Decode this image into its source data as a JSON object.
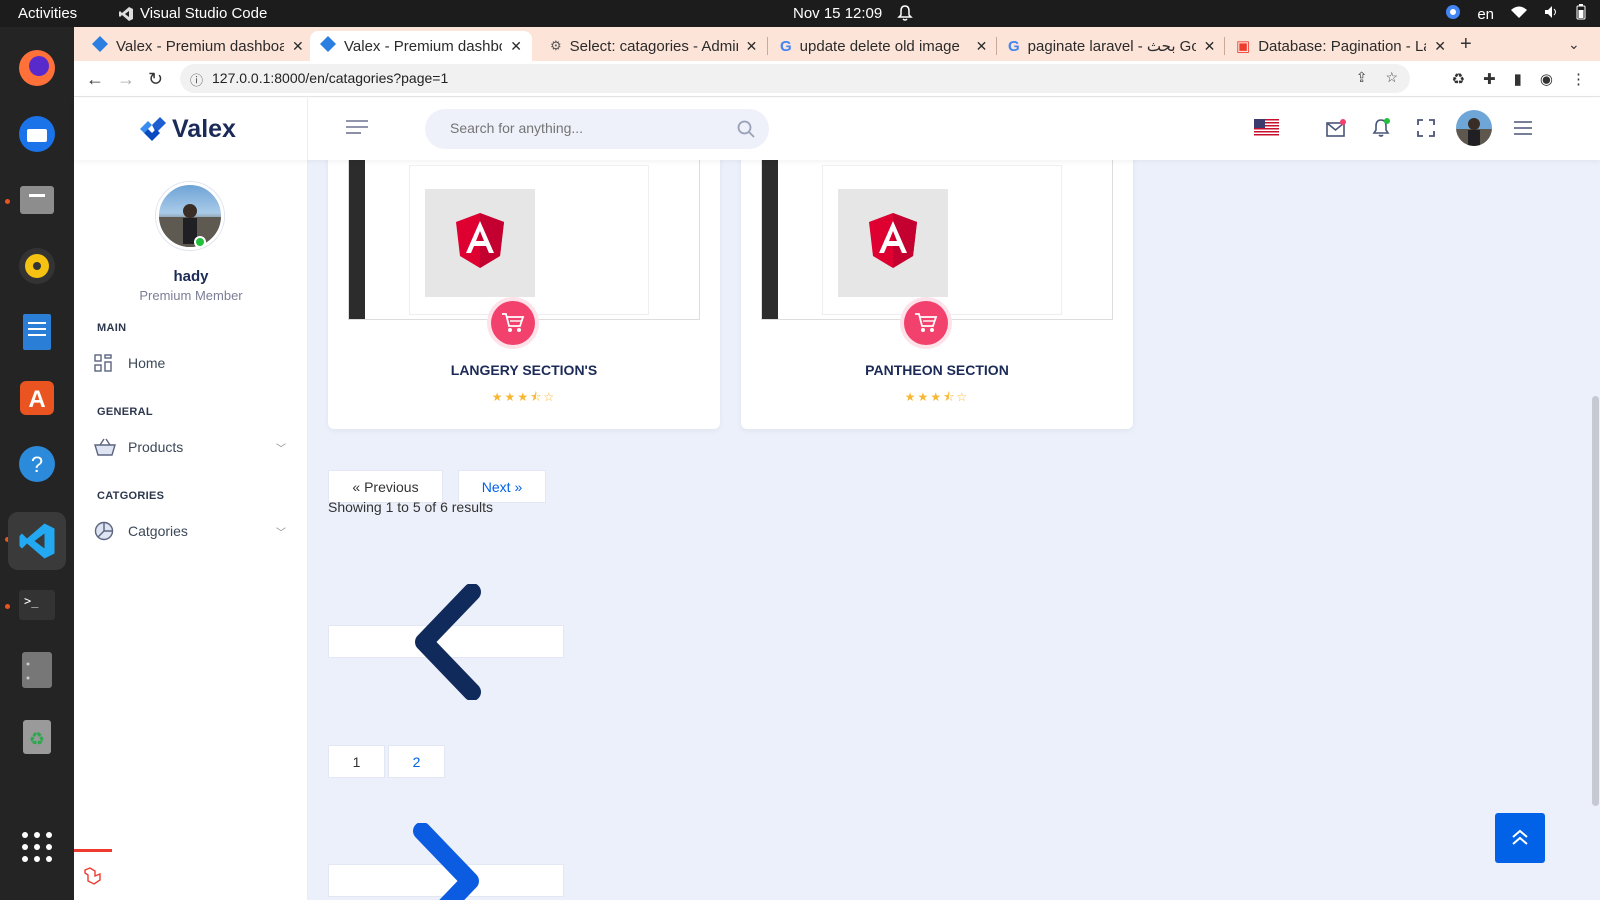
{
  "topbar": {
    "activities": "Activities",
    "app_name": "Visual Studio Code",
    "clock": "Nov 15  12:09",
    "lang": "en"
  },
  "tabs": [
    {
      "title": "Valex - Premium dashboard",
      "icon": "valex-favicon",
      "active": false
    },
    {
      "title": "Valex - Premium dashboard",
      "icon": "valex-favicon",
      "active": true
    },
    {
      "title": "Select: catagories - Admin",
      "icon": "phpmyadmin-favicon",
      "active": false
    },
    {
      "title": "update delete old image",
      "icon": "google-favicon",
      "active": false
    },
    {
      "title": "paginate laravel - بحث Google",
      "icon": "google-favicon",
      "active": false
    },
    {
      "title": "Database: Pagination - Laravel",
      "icon": "laravel-favicon",
      "active": false
    }
  ],
  "address": {
    "url": "127.0.0.1:8000/en/catagories?page=1"
  },
  "header": {
    "logo_text": "Valex",
    "search_placeholder": "Search for anything..."
  },
  "sidebar": {
    "user_name": "hady",
    "user_role": "Premium Member",
    "sections": [
      {
        "label": "MAIN",
        "items": [
          {
            "label": "Home",
            "icon": "grid-icon"
          }
        ]
      },
      {
        "label": "GENERAL",
        "items": [
          {
            "label": "Products",
            "icon": "basket-icon"
          }
        ]
      },
      {
        "label": "CATGORIES",
        "items": [
          {
            "label": "Catgories",
            "icon": "pie-chart-icon"
          }
        ]
      }
    ]
  },
  "cards": [
    {
      "title": "LANGERY SECTION'S",
      "rating": 3.5
    },
    {
      "title": "PANTHEON SECTION",
      "rating": 3.5
    }
  ],
  "pagination": {
    "previous": "« Previous",
    "next": "Next »",
    "showing": "Showing 1 to 5 of 6 results",
    "pages": [
      "1",
      "2"
    ],
    "current_page": "1"
  },
  "colors": {
    "accent": "#0162e8",
    "navy": "#1b2a57",
    "cart": "#f1416c",
    "background": "#ecf0fa"
  }
}
